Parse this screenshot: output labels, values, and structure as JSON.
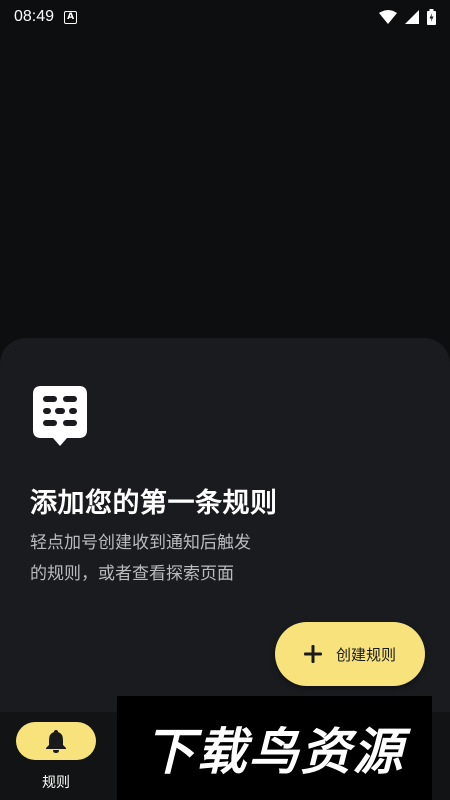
{
  "status_bar": {
    "time": "08:49",
    "badge": "A"
  },
  "empty_state": {
    "icon": "rule-keypad-icon",
    "title": "添加您的第一条规则",
    "description_line1": "轻点加号创建收到通知后触发",
    "description_line2": "的规则，或者查看探索页面"
  },
  "create_button": {
    "label": "创建规则",
    "icon": "plus-icon"
  },
  "bottom_nav": {
    "items": [
      {
        "label": "规则",
        "icon": "bell-icon",
        "active": true
      }
    ]
  },
  "watermark": {
    "text": "下载鸟资源"
  },
  "colors": {
    "background": "#0d0e10",
    "sheet": "#1a1b1e",
    "accent": "#f7e27c"
  }
}
